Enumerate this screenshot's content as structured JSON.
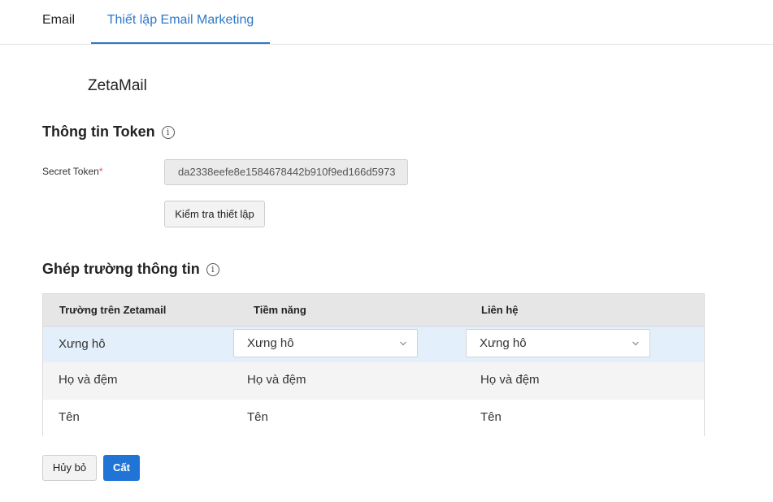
{
  "tabs": [
    {
      "label": "Email"
    },
    {
      "label": "Thiết lập Email Marketing"
    }
  ],
  "provider": "ZetaMail",
  "token_section": {
    "title": "Thông tin Token",
    "info_icon": "i",
    "field_label": "Secret Token",
    "required_mark": "*",
    "token_value": "da2338eefe8e1584678442b910f9ed166d5973",
    "check_button": "Kiểm tra thiết lập"
  },
  "mapping_section": {
    "title": "Ghép trường thông tin",
    "info_icon": "i",
    "columns": [
      "Trường trên Zetamail",
      "Tiềm năng",
      "Liên hệ"
    ],
    "rows": [
      {
        "field": "Xưng hô",
        "lead": "Xưng hô",
        "contact": "Xưng hô"
      },
      {
        "field": "Họ và đệm",
        "lead": "Họ và đệm",
        "contact": "Họ và đệm"
      },
      {
        "field": "Tên",
        "lead": "Tên",
        "contact": "Tên"
      }
    ]
  },
  "actions": {
    "cancel": "Hủy bỏ",
    "save": "Cất"
  },
  "colors": {
    "accent": "#2e78c8",
    "primary_button": "#1f74d6",
    "selected_row": "#e3f0fb"
  }
}
